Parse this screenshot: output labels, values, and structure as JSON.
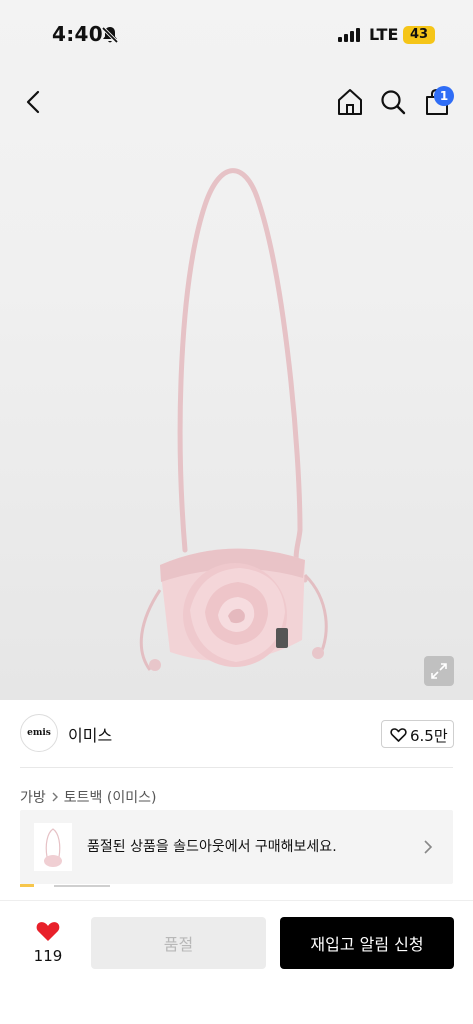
{
  "status_bar": {
    "time": "4:40",
    "network": "LTE",
    "battery": "43"
  },
  "nav": {
    "cart_count": "1"
  },
  "brand": {
    "logo_text": "emis",
    "name": "이미스",
    "likes": "6.5만"
  },
  "breadcrumb": {
    "items": [
      "가방",
      "토트백 (이미스)"
    ]
  },
  "soldout_banner": {
    "text": "품절된 상품을 솔드아웃에서 구매해보세요."
  },
  "bottom_bar": {
    "wish_count": "119",
    "soldout_label": "품절",
    "restock_label": "재입고 알림 신청"
  },
  "colors": {
    "accent_blue": "#2f6df6",
    "heart_red": "#e8202a",
    "battery_yellow": "#f5c518",
    "bag_pink": "#f2d3d6"
  }
}
